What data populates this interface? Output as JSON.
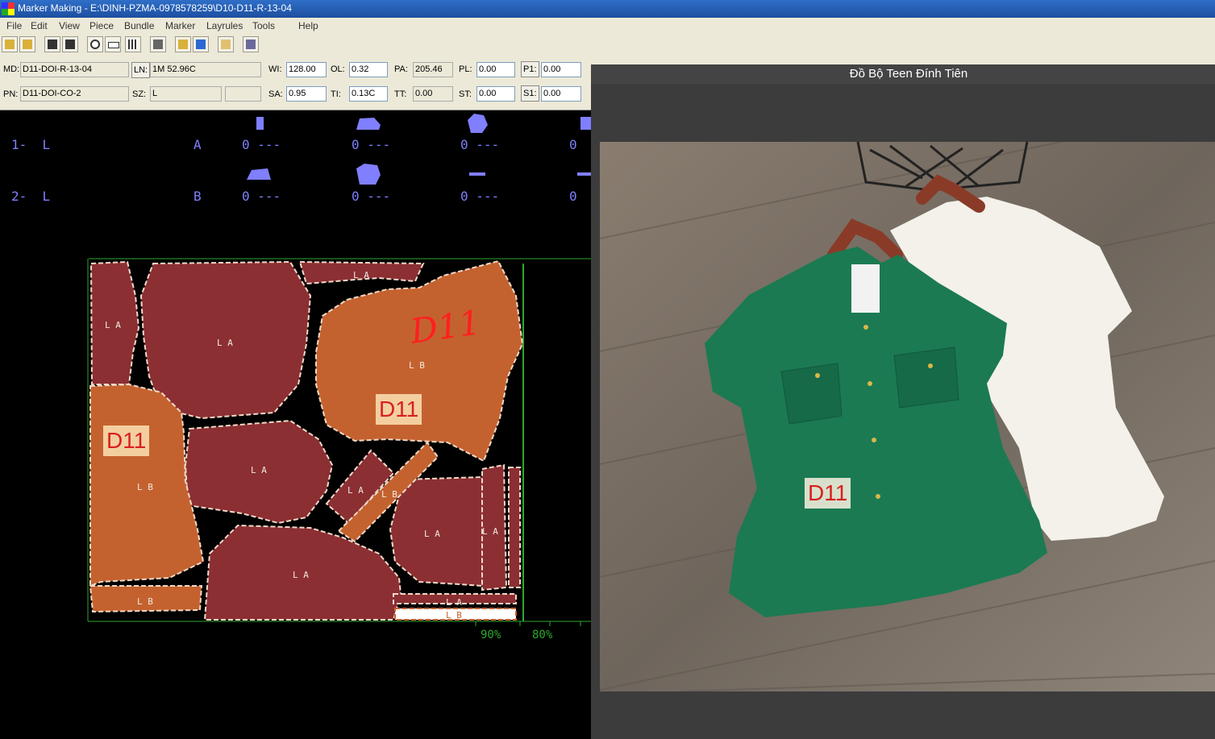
{
  "window": {
    "title": "Marker Making - E:\\DINH-PZMA-0978578259\\D10-D11-R-13-04"
  },
  "menu": [
    "File",
    "Edit",
    "View",
    "Piece",
    "Bundle",
    "Marker",
    "Layrules",
    "Tools",
    "Help"
  ],
  "fields": {
    "md_label": "MD:",
    "md_value": "D11-DOI-R-13-04",
    "pn_label": "PN:",
    "pn_value": "D11-DOI-CO-2",
    "ln_label": "LN:",
    "ln_value": "1M 52.96C",
    "sz_label": "SZ:",
    "sz_value": "L",
    "wi_label": "WI:",
    "wi_value": "128.00",
    "sa_label": "SA:",
    "sa_value": "0.95",
    "ol_label": "OL:",
    "ol_value": "0.32",
    "ti_label": "TI:",
    "ti_value": "0.13C",
    "pa_label": "PA:",
    "pa_value": "205.46",
    "tt_label": "TT:",
    "tt_value": "0.00",
    "pl_label": "PL:",
    "pl_value": "0.00",
    "st_label": "ST:",
    "st_value": "0.00",
    "p1_label": "P1:",
    "p1_value": "0.00",
    "s1_label": "S1:",
    "s1_value": "0.00"
  },
  "bundles": [
    {
      "row": "1-  L",
      "code": "A",
      "slots": [
        "0 ---",
        "0 ---",
        "0 ---",
        "0"
      ]
    },
    {
      "row": "2-  L",
      "code": "B",
      "slots": [
        "0 ---",
        "0 ---",
        "0 ---",
        "0"
      ]
    }
  ],
  "marker": {
    "piece_labels": [
      "L A",
      "L A",
      "L A",
      "L B",
      "L B",
      "L A",
      "L A",
      "L B",
      "L A",
      "L A",
      "L A",
      "L B",
      "L A",
      "L B"
    ],
    "d11_tag": "D11",
    "handwriting": "D11",
    "ruler": [
      "90%",
      "80%"
    ]
  },
  "viewer": {
    "title": "Đồ Bộ Teen Đính Tiên",
    "tag": "D11"
  },
  "colors": {
    "piece_a": "#8b2f33",
    "piece_b": "#c4622f",
    "marker_border": "#2ea82e",
    "bundle_blue": "#7f7fff",
    "shirt_green": "#1b7a52"
  }
}
